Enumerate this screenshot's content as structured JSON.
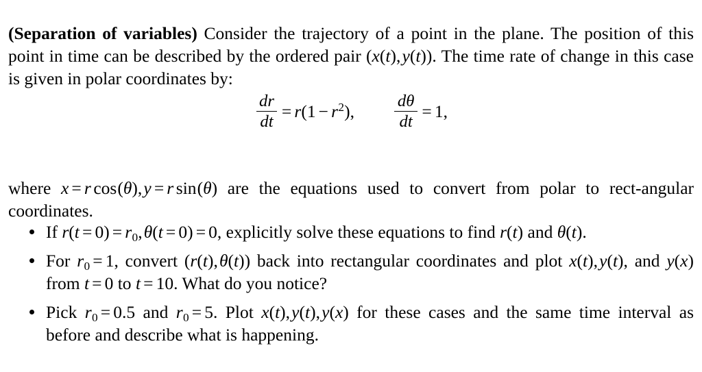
{
  "document": {
    "type": "math-exercise",
    "background_color": "#ffffff",
    "text_color": "#000000"
  },
  "intro": {
    "bold_lead": "(Separation of variables)",
    "text_after_lead": " Consider the trajectory of a point in the plane. The position of this point in time can be described by the ordered pair ",
    "ordered_pair": "(x(t), y(t))",
    "text_tail": ". The time rate of change in this case is given in polar coordinates by:"
  },
  "equation": {
    "lhs1_num": "dr",
    "lhs1_den": "dt",
    "rhs1": "= r(1 − r²),",
    "lhs2_num": "dθ",
    "lhs2_den": "dt",
    "rhs2": "= 1,",
    "plain": "dr/dt = r(1 - r^2),  dtheta/dt = 1,"
  },
  "where_paragraph": {
    "lead": "where ",
    "eq_x": "x = r cos(θ)",
    "comma": ", ",
    "eq_y": "y = r sin(θ)",
    "tail": " are the equations used to convert from polar to rect-angular coordinates.",
    "plain": "where x = r cos(theta), y = r sin(theta) are the equations used to convert from polar to rectangular coordinates."
  },
  "bullets": [
    {
      "id": "bullet-1",
      "plain": "If r(t = 0) = r_0, theta(t = 0) = 0, explicitly solve these equations to find r(t) and theta(t).",
      "parts": {
        "lead": "If ",
        "cond1": "r(t = 0) = r₀",
        "sep": ", ",
        "cond2": "θ(t = 0) = 0",
        "mid": ", explicitly solve these equations to find ",
        "target1": "r(t)",
        "conj": " and ",
        "target2": "θ(t)",
        "end": "."
      }
    },
    {
      "id": "bullet-2",
      "plain": "For r_0 = 1, convert (r(t), theta(t)) back into rectangular coordinates and plot x(t), y(t), and y(x) from t = 0 to t = 10. What do you notice?",
      "parts": {
        "lead": "For ",
        "cond": "r₀ = 1",
        "mid1": ", convert ",
        "pair": "(r(t), θ(t))",
        "mid2": " back into rectangular coordinates and plot ",
        "plot1": "x(t)",
        "c1": ", ",
        "plot2": "y(t)",
        "c2": ", and ",
        "plot3": "y(x)",
        "mid3": " from ",
        "t0": "t = 0",
        "to": " to ",
        "t1": "t = 10",
        "end": ". What do you notice?"
      }
    },
    {
      "id": "bullet-3",
      "plain": "Pick r_0 = 0.5 and r_0 = 5. Plot x(t), y(t), y(x) for these cases and the same time interval as before and describe what is happening.",
      "parts": {
        "lead": "Pick ",
        "cond1": "r₀ = 0.5",
        "conj": " and ",
        "cond2": "r₀ = 5",
        "mid": ". Plot ",
        "plot1": "x(t)",
        "c1": ", ",
        "plot2": "y(t)",
        "c2": ", ",
        "plot3": "y(x)",
        "end": " for these cases and the same time interval as before and describe what is happening."
      }
    }
  ]
}
